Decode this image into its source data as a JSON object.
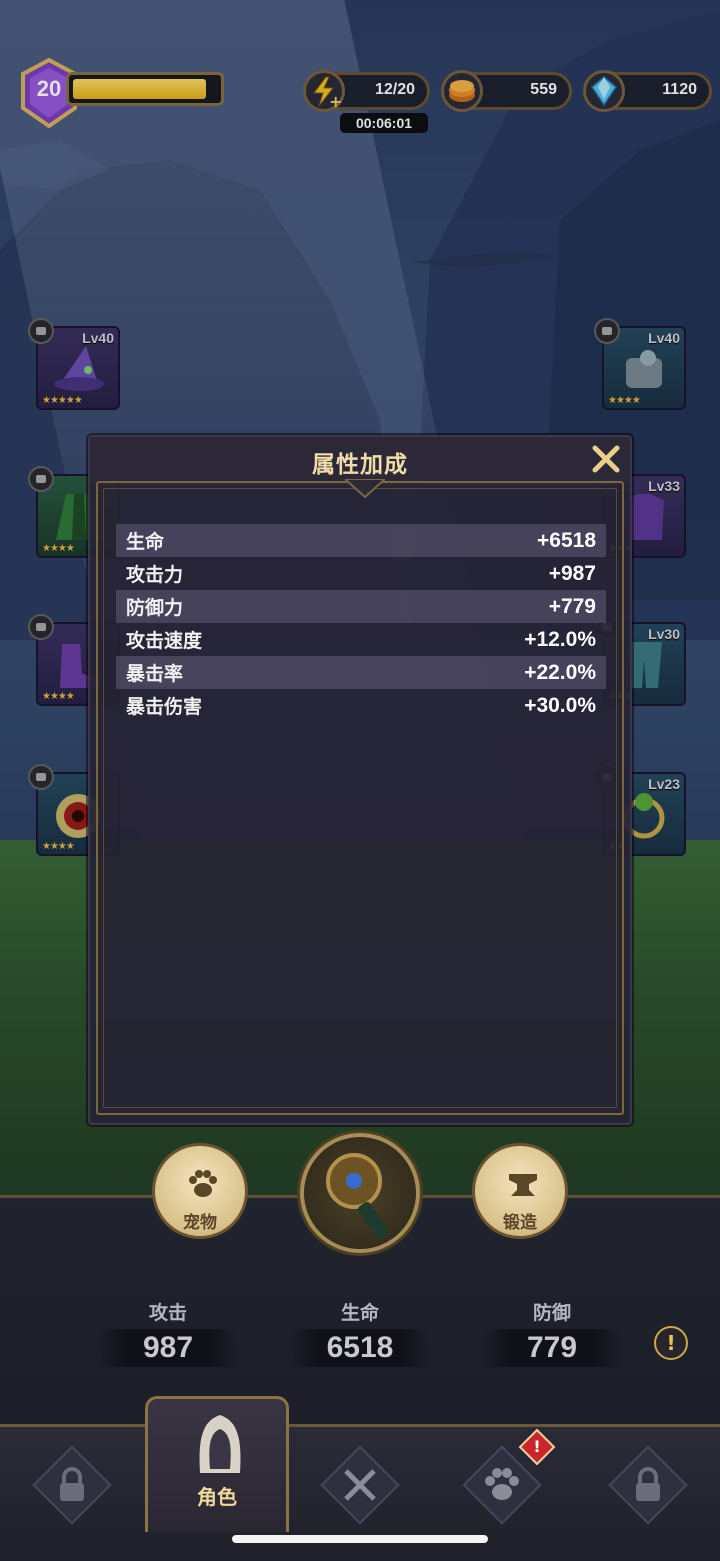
{
  "hud": {
    "level": "20",
    "xp_fraction": 0.93,
    "energy": "12/20",
    "energy_timer": "00:06:01",
    "gold": "559",
    "gems": "1120"
  },
  "equipment": {
    "left": [
      {
        "name": "wizard-hat",
        "level": "Lv40",
        "stars": "★★★★★"
      },
      {
        "name": "green-cloak",
        "level": "",
        "stars": "★★★★"
      },
      {
        "name": "purple-boots",
        "level": "",
        "stars": "★★★★"
      },
      {
        "name": "red-eye-amulet",
        "level": "",
        "stars": "★★★★"
      }
    ],
    "right": [
      {
        "name": "steel-gauntlet",
        "level": "Lv40",
        "stars": "★★★★"
      },
      {
        "name": "purple-armor",
        "level": "Lv33",
        "stars": "★★★"
      },
      {
        "name": "teal-leggings",
        "level": "Lv30",
        "stars": "★★★"
      },
      {
        "name": "green-ring",
        "level": "Lv23",
        "stars": "★★"
      }
    ]
  },
  "modal": {
    "title": "属性加成",
    "stats": [
      {
        "name": "生命",
        "value": "+6518"
      },
      {
        "name": "攻击力",
        "value": "+987"
      },
      {
        "name": "防御力",
        "value": "+779"
      },
      {
        "name": "攻击速度",
        "value": "+12.0%"
      },
      {
        "name": "暴击率",
        "value": "+22.0%"
      },
      {
        "name": "暴击伤害",
        "value": "+30.0%"
      }
    ]
  },
  "actions": {
    "pet_label": "宠物",
    "forge_label": "锻造"
  },
  "summary": {
    "attack_label": "攻击",
    "attack_value": "987",
    "hp_label": "生命",
    "hp_value": "6518",
    "defense_label": "防御",
    "defense_value": "779"
  },
  "nav": {
    "character_label": "角色",
    "info_mark": "!",
    "alert_mark": "!"
  }
}
